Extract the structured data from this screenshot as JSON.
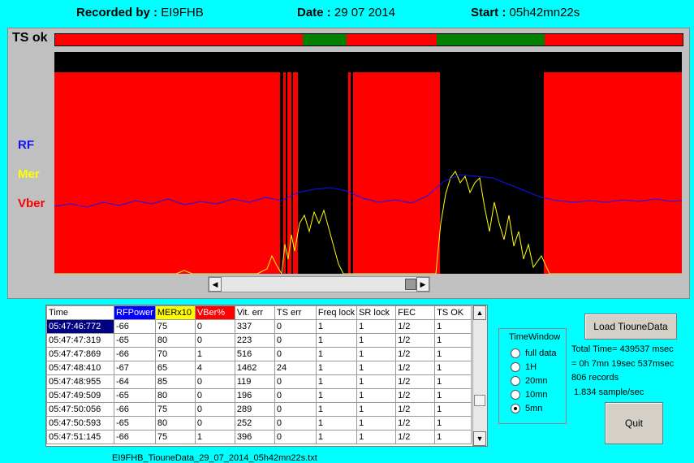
{
  "header": {
    "recorded_label": "Recorded by :",
    "recorded_value": "EI9FHB",
    "date_label": "Date :",
    "date_value": "29 07 2014",
    "start_label": "Start :",
    "start_value": "05h42mn22s"
  },
  "chart": {
    "tsok_label": "TS ok",
    "legend": {
      "rf": "RF",
      "mer": "Mer",
      "vber": "Vber"
    },
    "colors": {
      "rf": "#1010ff",
      "mer": "#ffff00",
      "vber": "#ff0000",
      "tsok_ok": "#008000",
      "tsok_err": "#ff0000",
      "lock_loss": "#000000"
    }
  },
  "scrollbar": {
    "left_icon": "arrow-left-icon",
    "right_icon": "arrow-right-icon",
    "position": 0.95
  },
  "table": {
    "headers": [
      "Time",
      "RFPower",
      "MERx10",
      "VBer%",
      "Vit. err",
      "TS err",
      "Freq lock",
      "SR lock",
      "FEC",
      "TS OK"
    ],
    "header_colors": [
      "",
      "#0000ff",
      "#ffff00",
      "#ff0000",
      "",
      "",
      "",
      "",
      "",
      ""
    ],
    "rows": [
      [
        "05:47:46:772",
        "-66",
        "75",
        "0",
        "337",
        "0",
        "1",
        "1",
        "1/2",
        "1"
      ],
      [
        "05:47:47:319",
        "-65",
        "80",
        "0",
        "223",
        "0",
        "1",
        "1",
        "1/2",
        "1"
      ],
      [
        "05:47:47:869",
        "-66",
        "70",
        "1",
        "516",
        "0",
        "1",
        "1",
        "1/2",
        "1"
      ],
      [
        "05:47:48:410",
        "-67",
        "65",
        "4",
        "1462",
        "24",
        "1",
        "1",
        "1/2",
        "1"
      ],
      [
        "05:47:48:955",
        "-64",
        "85",
        "0",
        "119",
        "0",
        "1",
        "1",
        "1/2",
        "1"
      ],
      [
        "05:47:49:509",
        "-65",
        "80",
        "0",
        "196",
        "0",
        "1",
        "1",
        "1/2",
        "1"
      ],
      [
        "05:47:50:056",
        "-66",
        "75",
        "0",
        "289",
        "0",
        "1",
        "1",
        "1/2",
        "1"
      ],
      [
        "05:47:50:593",
        "-65",
        "80",
        "0",
        "252",
        "0",
        "1",
        "1",
        "1/2",
        "1"
      ],
      [
        "05:47:51:145",
        "-66",
        "75",
        "1",
        "396",
        "0",
        "1",
        "1",
        "1/2",
        "1"
      ]
    ]
  },
  "filename": "EI9FHB_TiouneData_29_07_2014_05h42mn22s.txt",
  "timewindow": {
    "legend": "TimeWindow",
    "options": [
      "full data",
      "1H",
      "20mn",
      "10mn",
      "5mn"
    ],
    "selected": "5mn"
  },
  "buttons": {
    "load": "Load TiouneData",
    "quit": "Quit"
  },
  "info": {
    "total_time": "Total Time= 439537 msec",
    "duration": "= 0h 7mn 19sec 537msec",
    "records": "806 records",
    "rate": "1.834 sample/sec"
  }
}
